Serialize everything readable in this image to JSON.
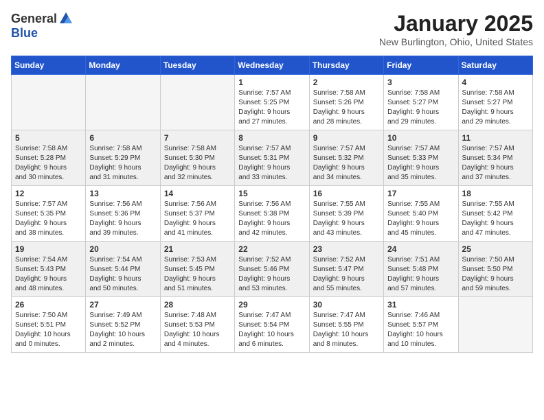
{
  "header": {
    "logo_general": "General",
    "logo_blue": "Blue",
    "month_title": "January 2025",
    "location": "New Burlington, Ohio, United States"
  },
  "weekdays": [
    "Sunday",
    "Monday",
    "Tuesday",
    "Wednesday",
    "Thursday",
    "Friday",
    "Saturday"
  ],
  "weeks": [
    {
      "shaded": false,
      "days": [
        {
          "number": "",
          "info": ""
        },
        {
          "number": "",
          "info": ""
        },
        {
          "number": "",
          "info": ""
        },
        {
          "number": "1",
          "info": "Sunrise: 7:57 AM\nSunset: 5:25 PM\nDaylight: 9 hours\nand 27 minutes."
        },
        {
          "number": "2",
          "info": "Sunrise: 7:58 AM\nSunset: 5:26 PM\nDaylight: 9 hours\nand 28 minutes."
        },
        {
          "number": "3",
          "info": "Sunrise: 7:58 AM\nSunset: 5:27 PM\nDaylight: 9 hours\nand 29 minutes."
        },
        {
          "number": "4",
          "info": "Sunrise: 7:58 AM\nSunset: 5:27 PM\nDaylight: 9 hours\nand 29 minutes."
        }
      ]
    },
    {
      "shaded": true,
      "days": [
        {
          "number": "5",
          "info": "Sunrise: 7:58 AM\nSunset: 5:28 PM\nDaylight: 9 hours\nand 30 minutes."
        },
        {
          "number": "6",
          "info": "Sunrise: 7:58 AM\nSunset: 5:29 PM\nDaylight: 9 hours\nand 31 minutes."
        },
        {
          "number": "7",
          "info": "Sunrise: 7:58 AM\nSunset: 5:30 PM\nDaylight: 9 hours\nand 32 minutes."
        },
        {
          "number": "8",
          "info": "Sunrise: 7:57 AM\nSunset: 5:31 PM\nDaylight: 9 hours\nand 33 minutes."
        },
        {
          "number": "9",
          "info": "Sunrise: 7:57 AM\nSunset: 5:32 PM\nDaylight: 9 hours\nand 34 minutes."
        },
        {
          "number": "10",
          "info": "Sunrise: 7:57 AM\nSunset: 5:33 PM\nDaylight: 9 hours\nand 35 minutes."
        },
        {
          "number": "11",
          "info": "Sunrise: 7:57 AM\nSunset: 5:34 PM\nDaylight: 9 hours\nand 37 minutes."
        }
      ]
    },
    {
      "shaded": false,
      "days": [
        {
          "number": "12",
          "info": "Sunrise: 7:57 AM\nSunset: 5:35 PM\nDaylight: 9 hours\nand 38 minutes."
        },
        {
          "number": "13",
          "info": "Sunrise: 7:56 AM\nSunset: 5:36 PM\nDaylight: 9 hours\nand 39 minutes."
        },
        {
          "number": "14",
          "info": "Sunrise: 7:56 AM\nSunset: 5:37 PM\nDaylight: 9 hours\nand 41 minutes."
        },
        {
          "number": "15",
          "info": "Sunrise: 7:56 AM\nSunset: 5:38 PM\nDaylight: 9 hours\nand 42 minutes."
        },
        {
          "number": "16",
          "info": "Sunrise: 7:55 AM\nSunset: 5:39 PM\nDaylight: 9 hours\nand 43 minutes."
        },
        {
          "number": "17",
          "info": "Sunrise: 7:55 AM\nSunset: 5:40 PM\nDaylight: 9 hours\nand 45 minutes."
        },
        {
          "number": "18",
          "info": "Sunrise: 7:55 AM\nSunset: 5:42 PM\nDaylight: 9 hours\nand 47 minutes."
        }
      ]
    },
    {
      "shaded": true,
      "days": [
        {
          "number": "19",
          "info": "Sunrise: 7:54 AM\nSunset: 5:43 PM\nDaylight: 9 hours\nand 48 minutes."
        },
        {
          "number": "20",
          "info": "Sunrise: 7:54 AM\nSunset: 5:44 PM\nDaylight: 9 hours\nand 50 minutes."
        },
        {
          "number": "21",
          "info": "Sunrise: 7:53 AM\nSunset: 5:45 PM\nDaylight: 9 hours\nand 51 minutes."
        },
        {
          "number": "22",
          "info": "Sunrise: 7:52 AM\nSunset: 5:46 PM\nDaylight: 9 hours\nand 53 minutes."
        },
        {
          "number": "23",
          "info": "Sunrise: 7:52 AM\nSunset: 5:47 PM\nDaylight: 9 hours\nand 55 minutes."
        },
        {
          "number": "24",
          "info": "Sunrise: 7:51 AM\nSunset: 5:48 PM\nDaylight: 9 hours\nand 57 minutes."
        },
        {
          "number": "25",
          "info": "Sunrise: 7:50 AM\nSunset: 5:50 PM\nDaylight: 9 hours\nand 59 minutes."
        }
      ]
    },
    {
      "shaded": false,
      "days": [
        {
          "number": "26",
          "info": "Sunrise: 7:50 AM\nSunset: 5:51 PM\nDaylight: 10 hours\nand 0 minutes."
        },
        {
          "number": "27",
          "info": "Sunrise: 7:49 AM\nSunset: 5:52 PM\nDaylight: 10 hours\nand 2 minutes."
        },
        {
          "number": "28",
          "info": "Sunrise: 7:48 AM\nSunset: 5:53 PM\nDaylight: 10 hours\nand 4 minutes."
        },
        {
          "number": "29",
          "info": "Sunrise: 7:47 AM\nSunset: 5:54 PM\nDaylight: 10 hours\nand 6 minutes."
        },
        {
          "number": "30",
          "info": "Sunrise: 7:47 AM\nSunset: 5:55 PM\nDaylight: 10 hours\nand 8 minutes."
        },
        {
          "number": "31",
          "info": "Sunrise: 7:46 AM\nSunset: 5:57 PM\nDaylight: 10 hours\nand 10 minutes."
        },
        {
          "number": "",
          "info": ""
        }
      ]
    }
  ]
}
